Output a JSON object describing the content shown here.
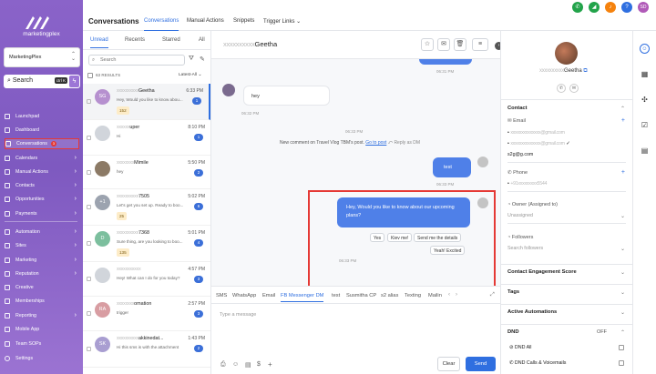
{
  "sidebar": {
    "brand": "marketingplex",
    "account_name": "MarketingPlex",
    "search_label": "Search",
    "search_shortcut": "ctrl K",
    "nav": [
      {
        "label": "Launchpad",
        "icon": "rocket-icon"
      },
      {
        "label": "Dashboard",
        "icon": "dashboard-icon"
      },
      {
        "label": "Conversations",
        "icon": "chat-icon",
        "badge": "3",
        "active": true
      },
      {
        "label": "Calendars",
        "icon": "calendar-icon"
      },
      {
        "label": "Manual Actions",
        "icon": "hand-icon"
      },
      {
        "label": "Contacts",
        "icon": "contacts-icon"
      },
      {
        "label": "Opportunities",
        "icon": "funnel-icon"
      },
      {
        "label": "Payments",
        "icon": "payments-icon"
      },
      {
        "label": "Automation",
        "icon": "automation-icon"
      },
      {
        "label": "Sites",
        "icon": "globe-icon"
      },
      {
        "label": "Marketing",
        "icon": "megaphone-icon"
      },
      {
        "label": "Reputation",
        "icon": "star-icon"
      },
      {
        "label": "Creative",
        "icon": "palette-icon"
      },
      {
        "label": "Memberships",
        "icon": "membership-icon"
      },
      {
        "label": "Reporting",
        "icon": "chart-icon"
      },
      {
        "label": "Mobile App",
        "icon": "mobile-icon"
      },
      {
        "label": "Team SOPs",
        "icon": "document-icon"
      }
    ],
    "settings_label": "Settings"
  },
  "header": {
    "title": "Conversations",
    "tabs": [
      "Conversations",
      "Manual Actions",
      "Snippets",
      "Trigger Links"
    ],
    "avatar_initials": "SD",
    "notification_count": "3"
  },
  "list": {
    "tabs": [
      "Unread",
      "Recents",
      "Starred",
      "All"
    ],
    "search_placeholder": "Search",
    "results_count": "63 RESULTS",
    "sort_label": "Latest-All",
    "rows": [
      {
        "initials": "SG",
        "name_blur": "xxxxxxxxxx",
        "name": "Geetha",
        "msg": "Hey, Would you like to know abou...",
        "time": "6:33 PM",
        "count": "1",
        "tag": "152",
        "color": "#b690cf"
      },
      {
        "initials": "",
        "name_blur": "xxxxxx",
        "name": "uper",
        "msg": "Hi",
        "time": "8:10 PM",
        "count": "1",
        "tag": "",
        "color": "#d1d5db"
      },
      {
        "initials": "",
        "name_blur": "xxxxxxxx",
        "name": "Mimile",
        "msg": "hey",
        "time": "5:50 PM",
        "count": "2",
        "tag": "",
        "color": "#8c7a66"
      },
      {
        "initials": "+1",
        "name_blur": "xxxxxxxxxx",
        "name": "7505",
        "msg": "Let's get you set up. Ready to boo...",
        "time": "5:02 PM",
        "count": "6",
        "tag": "25",
        "color": "#9ca3af"
      },
      {
        "initials": "D",
        "name_blur": "xxxxxxxxxx",
        "name": "7368",
        "msg": "Sure thing, are you looking to boo...",
        "time": "5:01 PM",
        "count": "4",
        "tag": "135",
        "color": "#7cbf9e"
      },
      {
        "initials": "",
        "name_blur": "xxxxxxxxxxx",
        "name": "",
        "msg": "Hey! What can I do for you today?",
        "time": "4:57 PM",
        "count": "3",
        "tag": "",
        "color": "#d1d5db"
      },
      {
        "initials": "RA",
        "name_blur": "xxxxxxxx",
        "name": "omation",
        "msg": "trigger",
        "time": "2:57 PM",
        "count": "3",
        "tag": "",
        "color": "#d89da2"
      },
      {
        "initials": "SK",
        "name_blur": "xxxxxxxxxx",
        "name": "akkinedat...",
        "msg": "Hi this sms is with the attachment",
        "time": "1:43 PM",
        "count": "2",
        "tag": "",
        "color": "#a99ed1"
      }
    ]
  },
  "chat": {
    "contact_blur": "xxxxxxxxxx",
    "contact_name": "Geetha",
    "msg_in_1": "hey",
    "ts_top": "06:31 PM",
    "ts_in_1": "06:32 PM",
    "ts_center": "06:33 PM",
    "notice_text": "New comment on Travel Vlog TBM's post.",
    "notice_link": "Go to post",
    "notice_reply": "Reply as DM",
    "msg_out_1": "test",
    "ts_out_1": "06:33 PM",
    "msg_out_2": "Hey, Would you like to know about our upcoming plans?",
    "quick_replies": [
      "Yes",
      "Kiev me!",
      "Send me the details",
      "Yeah! Excited"
    ],
    "ts_out_2": "06:33 PM",
    "channel_tabs": [
      "SMS",
      "WhatsApp",
      "Email",
      "FB Messenger DM",
      "test",
      "Susmitha CP",
      "s2 alias",
      "Texting",
      "Mailin"
    ],
    "compose_placeholder": "Type a message",
    "clear_label": "Clear",
    "send_label": "Send"
  },
  "contact": {
    "name_blur": "xxxxxxxxxx",
    "name": "Geetha",
    "contact_section": "Contact",
    "email_label": "Email",
    "emails": [
      "xxxxxxxxxxxxxx@gmail.com",
      "xxxxxxxxxxxxxx@gmail.com",
      "s2g@g.com"
    ],
    "phone_label": "Phone",
    "phone": "+91xxxxxxxxx5544",
    "owner_label": "Owner (Assigned to)",
    "owner_value": "Unassigned",
    "followers_label": "Followers",
    "followers_placeholder": "Search followers",
    "sections": [
      "Contact Engagement Score",
      "Tags",
      "Active Automations",
      "DND"
    ],
    "dnd_state": "OFF",
    "dnd_all": "DND All",
    "dnd_calls": "DND Calls & Voicemails"
  },
  "colors": {
    "accent": "#2f6fe0",
    "sidebar": "#8a63c9",
    "highlight_border": "#e53935"
  }
}
